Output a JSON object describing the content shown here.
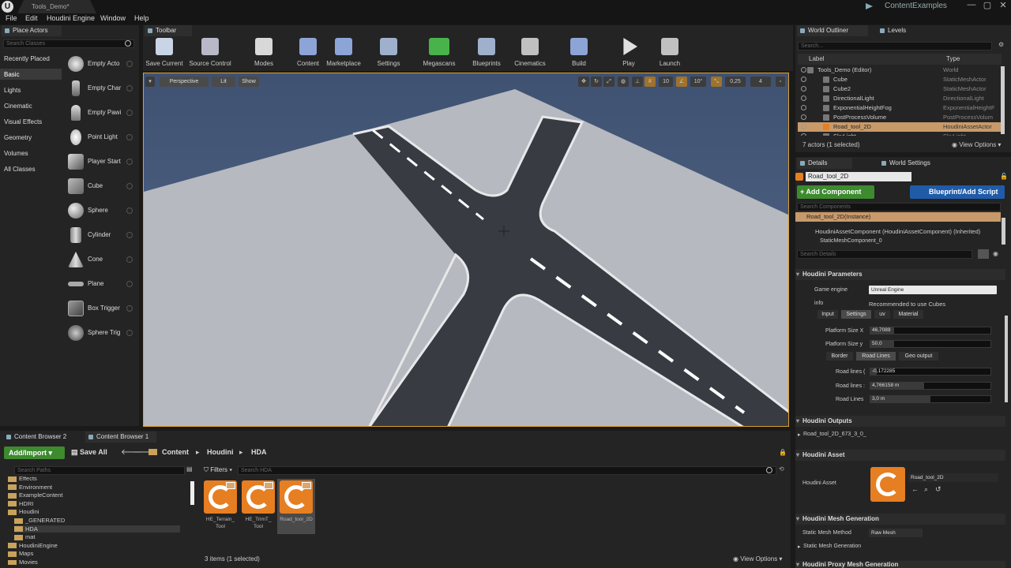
{
  "window": {
    "doc_tab": "Tools_Demo*",
    "project": "ContentExamples",
    "controls": [
      "—",
      "▢",
      "✕"
    ]
  },
  "menu": [
    "File",
    "Edit",
    "Houdini Engine",
    "Window",
    "Help"
  ],
  "place_actors": {
    "tab": "Place Actors",
    "search_placeholder": "Search Classes",
    "categories": [
      "Recently Placed",
      "Basic",
      "Lights",
      "Cinematic",
      "Visual Effects",
      "Geometry",
      "Volumes",
      "All Classes"
    ],
    "selected_category": "Basic",
    "actors": [
      "Empty Acto",
      "Empty Char",
      "Empty Pawi",
      "Point Light",
      "Player Start",
      "Cube",
      "Sphere",
      "Cylinder",
      "Cone",
      "Plane",
      "Box Trigger",
      "Sphere Trig"
    ]
  },
  "toolbar": {
    "tab": "Toolbar",
    "buttons": [
      {
        "label": "Save Current",
        "icon": "save-icon",
        "color": "#c9d4e6"
      },
      {
        "label": "Source Control",
        "icon": "source-control-icon",
        "color": "#b8b8c8"
      },
      {
        "label": "Modes",
        "icon": "modes-icon",
        "color": "#d8d8d8"
      },
      {
        "label": "Content",
        "icon": "content-icon",
        "color": "#8da4d6"
      },
      {
        "label": "Marketplace",
        "icon": "marketplace-icon",
        "color": "#8da4d6"
      },
      {
        "label": "Settings",
        "icon": "settings-icon",
        "color": "#9fb0cc"
      },
      {
        "label": "Megascans",
        "icon": "megascans-icon",
        "color": "#47b34a"
      },
      {
        "label": "Blueprints",
        "icon": "blueprints-icon",
        "color": "#9fb0cc"
      },
      {
        "label": "Cinematics",
        "icon": "cinematics-icon",
        "color": "#c0c0c0"
      },
      {
        "label": "Build",
        "icon": "build-icon",
        "color": "#8da4d6"
      },
      {
        "label": "Play",
        "icon": "play-icon",
        "color": "#e0e0e0"
      },
      {
        "label": "Launch",
        "icon": "launch-icon",
        "color": "#c0c0c0"
      }
    ]
  },
  "viewport": {
    "perspective": "Perspective",
    "lit": "Lit",
    "show": "Show",
    "grid_snap": "10",
    "rot_snap": "10°",
    "scale_snap": "0,25",
    "cam_speed": "4",
    "sky_color": "#4a5b7a",
    "ground_color": "#b4b7bd",
    "road_color": "#3a3d44"
  },
  "world_outliner": {
    "tab": "World Outliner",
    "tab2": "Levels",
    "search_placeholder": "Search...",
    "col_label": "Label",
    "col_type": "Type",
    "rows": [
      {
        "label": "Tools_Demo (Editor)",
        "type": "World",
        "selected": false
      },
      {
        "label": "Cube",
        "type": "StaticMeshActor",
        "selected": false
      },
      {
        "label": "Cube2",
        "type": "StaticMeshActor",
        "selected": false
      },
      {
        "label": "DirectionalLight",
        "type": "DirectionalLight",
        "selected": false
      },
      {
        "label": "ExponentialHeightFog",
        "type": "ExponentialHeightF",
        "selected": false
      },
      {
        "label": "PostProcessVolume",
        "type": "PostProcessVolum",
        "selected": false
      },
      {
        "label": "Road_tool_2D",
        "type": "HoudiniAssetActor",
        "selected": true
      },
      {
        "label": "SkyLight",
        "type": "SkyLight",
        "selected": false
      }
    ],
    "status": "7 actors (1 selected)",
    "view_options": "View Options"
  },
  "details": {
    "tab": "Details",
    "tab2": "World Settings",
    "name_value": "Road_tool_2D",
    "add_component": "+ Add Component",
    "blueprint_btn": "Blueprint/Add Script",
    "search_components": "Search Components",
    "instance": "Road_tool_2D(Instance)",
    "component": "HoudiniAssetComponent (HoudiniAssetComponent) (Inherited)",
    "sub_component": "StaticMeshComponent_0",
    "search_details": "Search Details",
    "houdini_parameters": "Houdini Parameters",
    "game_engine_label": "Game engine",
    "game_engine_value": "Unreal Engine",
    "info_label": "info",
    "info_value": "Recommended to use Cubes",
    "param_tabs": [
      "Input",
      "Settings",
      "uv",
      "Material"
    ],
    "platform_x_label": "Platform Size X",
    "platform_x_value": "46,7089",
    "platform_y_label": "Platform Size y",
    "platform_y_value": "50,0",
    "sub_tabs": [
      "Border",
      "Road Lines",
      "Geo output"
    ],
    "road_lines_1_label": "Road lines (",
    "road_lines_1_value": "-0,172285",
    "road_lines_2_label": "Road lines :",
    "road_lines_2_value": "4,766158 m",
    "road_lines_3_label": "Road Lines",
    "road_lines_3_value": "3,0 m",
    "houdini_outputs": "Houdini Outputs",
    "output_item": "Road_tool_2D_673_3_0_",
    "houdini_asset_section": "Houdini Asset",
    "houdini_asset_label": "Houdini Asset",
    "houdini_asset_value": "Road_tool_2D",
    "mesh_gen_section": "Houdini Mesh Generation",
    "static_mesh_method_label": "Static Mesh Method",
    "static_mesh_method_value": "Raw Mesh",
    "static_mesh_generation": "Static Mesh Generation",
    "cut_section": "Houdini Proxy Mesh Generation"
  },
  "content_browser": {
    "tab1": "Content Browser 2",
    "tab2": "Content Browser 1",
    "add_import": "Add/Import",
    "save_all": "Save All",
    "path": [
      "Content",
      "Houdini",
      "HDA"
    ],
    "search_paths": "Search Paths",
    "filters": "Filters",
    "search_hda": "Search HDA",
    "tree": [
      {
        "label": "Effects",
        "indent": 1
      },
      {
        "label": "Environment",
        "indent": 1
      },
      {
        "label": "ExampleContent",
        "indent": 1
      },
      {
        "label": "HDRI",
        "indent": 1
      },
      {
        "label": "Houdini",
        "indent": 1
      },
      {
        "label": "_GENERATED",
        "indent": 2
      },
      {
        "label": "HDA",
        "indent": 2
      },
      {
        "label": "mat",
        "indent": 2
      },
      {
        "label": "HoudiniEngine",
        "indent": 1
      },
      {
        "label": "Maps",
        "indent": 1
      },
      {
        "label": "Movies",
        "indent": 1
      }
    ],
    "selected_folder": "HDA",
    "assets": [
      {
        "label": "HE_Terrain_\nTool",
        "selected": false
      },
      {
        "label": "HE_TrimT_\nTool",
        "selected": false
      },
      {
        "label": "Road_tool_2D",
        "selected": true
      }
    ],
    "status": "3 items (1 selected)",
    "view_options": "View Options"
  }
}
